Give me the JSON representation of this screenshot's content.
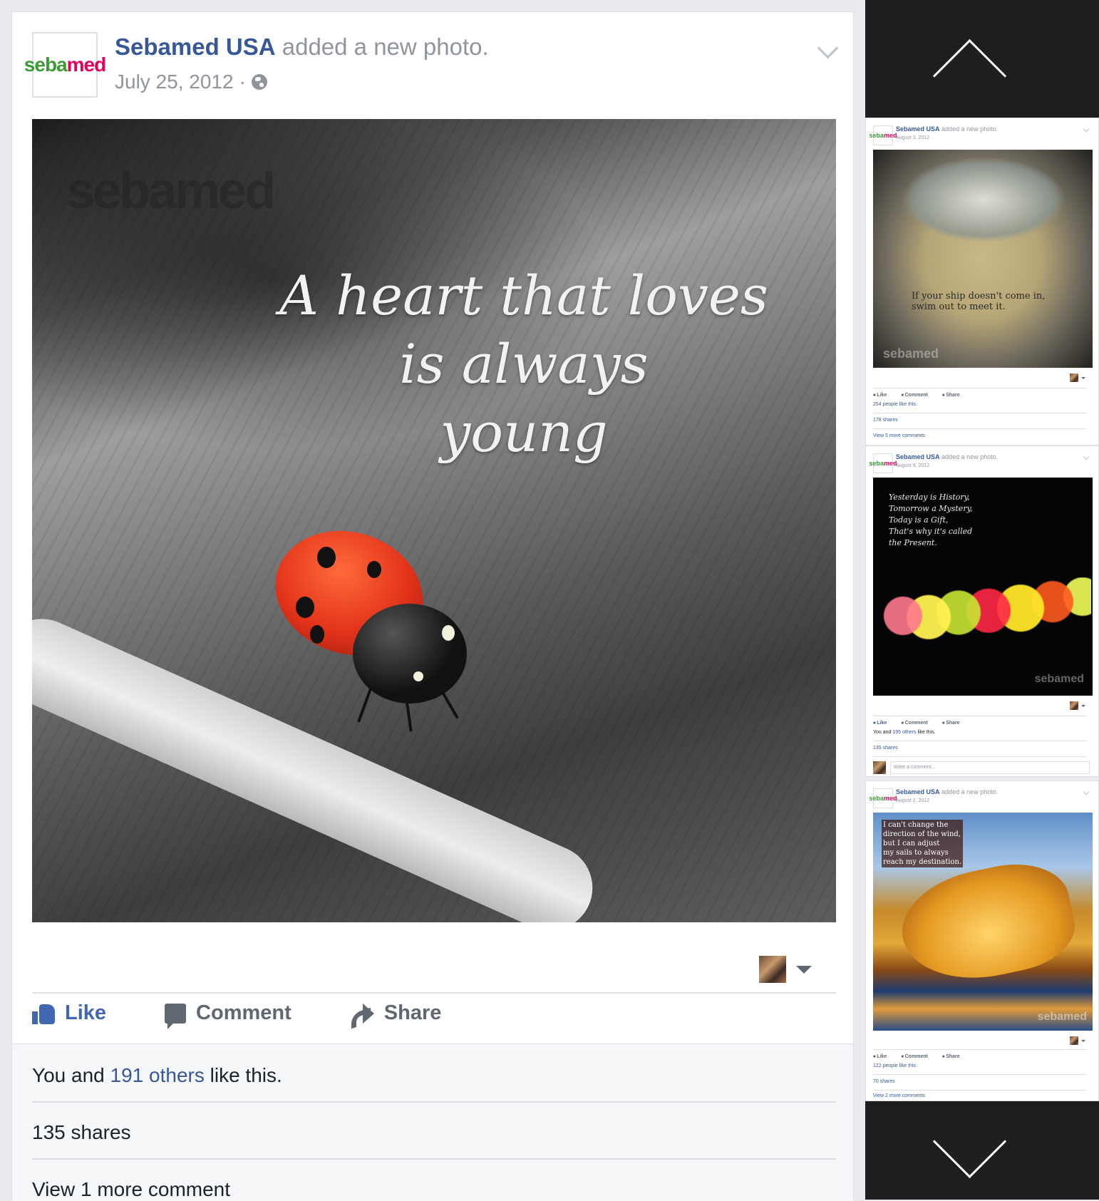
{
  "main_post": {
    "page_name": "Sebamed USA",
    "action_text": "added a new photo.",
    "date": "July 25, 2012",
    "date_separator": "·",
    "logo": {
      "part1": "seba",
      "part2": "med"
    },
    "photo": {
      "watermark": "sebamed",
      "quote": "A heart that loves\nis always\nyoung"
    },
    "actions": {
      "like": "Like",
      "comment": "Comment",
      "share": "Share"
    },
    "likes_prefix": "You and",
    "likes_link": "191 others",
    "likes_suffix": "like this.",
    "shares": "135 shares",
    "view_comments": "View 1 more comment"
  },
  "sidebar": {
    "posts": [
      {
        "page_name": "Sebamed USA",
        "action_text": "added a new photo.",
        "date": "August 3, 2012 ·",
        "quote": "If your ship doesn't come in,\nswim out to meet it.",
        "actions": {
          "like": "Like",
          "comment": "Comment",
          "share": "Share"
        },
        "likes": "254 people like this.",
        "shares": "178 shares",
        "view_comments": "View 5 more comments"
      },
      {
        "page_name": "Sebamed USA",
        "action_text": "added a new photo.",
        "date": "August 9, 2012 ·",
        "quote": "Yesterday is History,\nTomorrow a Mystery,\nToday is a Gift,\nThat's why it's called\nthe Present.",
        "actions": {
          "like": "Like",
          "comment": "Comment",
          "share": "Share"
        },
        "likes_prefix": "You and",
        "likes_link": "195 others",
        "likes_suffix": "like this.",
        "shares": "135 shares",
        "comment_placeholder": "Write a comment..."
      },
      {
        "page_name": "Sebamed USA",
        "action_text": "added a new photo.",
        "date": "August 2, 2012 ·",
        "quote": "I can't change the\ndirection of the wind,\nbut I can adjust\nmy sails to always\nreach my destination.",
        "actions": {
          "like": "Like",
          "comment": "Comment",
          "share": "Share"
        },
        "likes": "122 people like this.",
        "shares": "70 shares",
        "view_comments": "View 2 more comments"
      }
    ]
  },
  "icons": {
    "nav_up": "chevron-up-icon",
    "nav_down": "chevron-down-icon",
    "globe": "globe-icon",
    "like": "thumbs-up-icon",
    "comment": "comment-icon",
    "share": "share-icon"
  },
  "colors": {
    "link": "#365899",
    "like_blue": "#4267b2",
    "muted": "#90949c",
    "background": "#e9ebee",
    "nav_dark": "#1e1e1e"
  }
}
